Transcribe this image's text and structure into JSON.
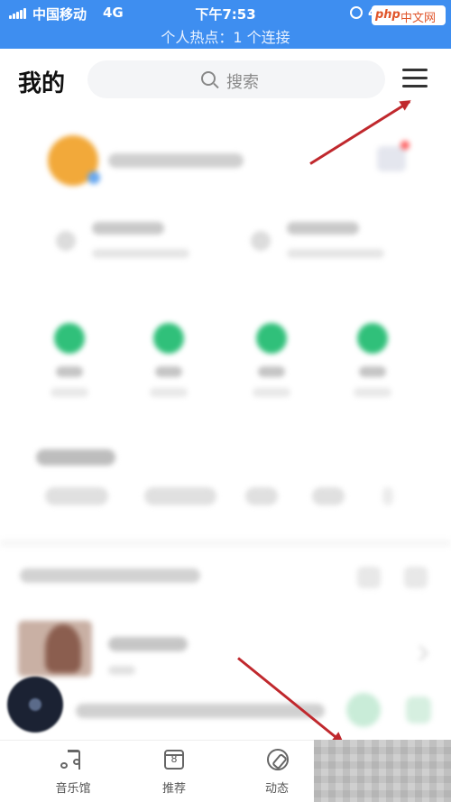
{
  "status_bar": {
    "carrier": "中国移动",
    "network": "4G",
    "time": "下午7:53",
    "battery_partial": "4",
    "hotspot_banner": "个人热点：1 个连接",
    "watermark_brand": "php",
    "watermark_site": "中文网"
  },
  "header": {
    "title": "我的",
    "search_placeholder": "搜索"
  },
  "bottom_nav": {
    "items": [
      {
        "label": "音乐馆",
        "icon": "music-note-icon"
      },
      {
        "label": "推荐",
        "icon": "calendar-icon",
        "glyph": "8"
      },
      {
        "label": "动态",
        "icon": "compass-icon"
      }
    ]
  },
  "annotations": {
    "arrow_color": "#c0282d"
  },
  "colors": {
    "status_bar_bg": "#3e8ef0",
    "accent_green": "#30c07a"
  }
}
